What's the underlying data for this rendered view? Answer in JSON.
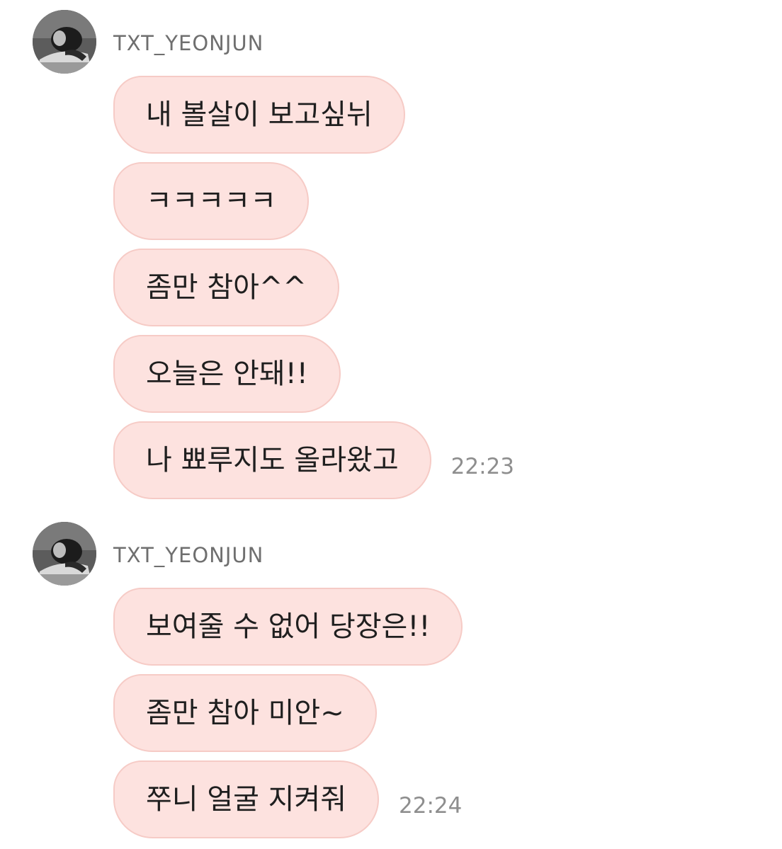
{
  "theme": {
    "bubble_bg": "#fde2df",
    "bubble_border": "#f6cbc6",
    "sender_color": "#6f6f6f",
    "time_color": "#8e8e8e"
  },
  "groups": [
    {
      "sender": "TXT_YEONJUN",
      "avatar_icon": "profile-photo-avatar",
      "messages": [
        {
          "text": "내 볼살이 보고싶뉘"
        },
        {
          "text": "ㅋㅋㅋㅋㅋ"
        },
        {
          "text": "좀만 참아^^"
        },
        {
          "text": "오늘은 안돼!!"
        },
        {
          "text": "나 뾰루지도 올라왔고",
          "time": "22:23"
        }
      ]
    },
    {
      "sender": "TXT_YEONJUN",
      "avatar_icon": "profile-photo-avatar",
      "messages": [
        {
          "text": "보여줄 수 없어 당장은!!"
        },
        {
          "text": "좀만 참아 미안~"
        },
        {
          "text": "쭈니 얼굴 지켜줘",
          "time": "22:24"
        }
      ]
    }
  ]
}
